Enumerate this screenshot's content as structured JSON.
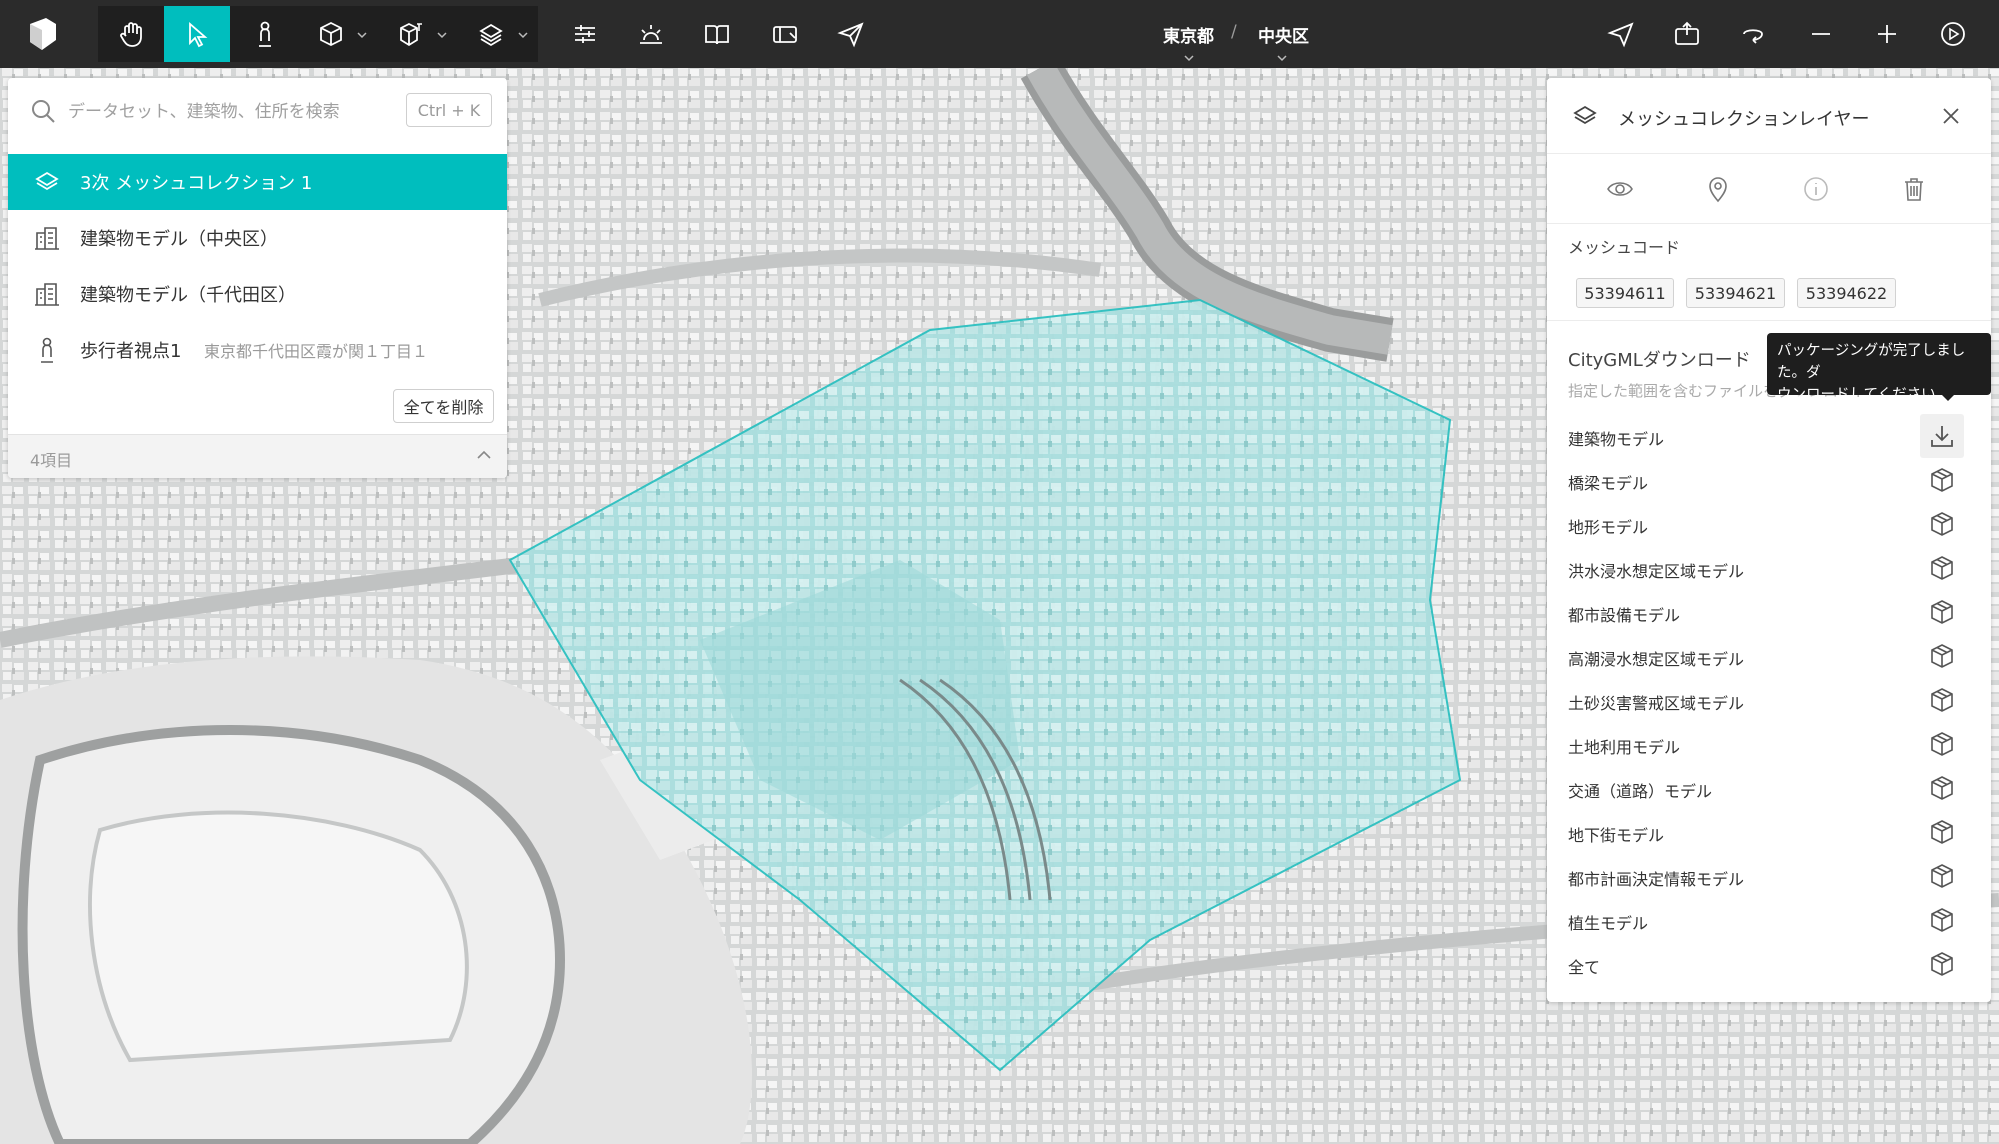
{
  "toolbar": {
    "tools": [
      {
        "name": "hand-tool",
        "icon": "hand-icon"
      },
      {
        "name": "select-tool",
        "icon": "cursor-icon",
        "active": true
      },
      {
        "name": "pedestrian-tool",
        "icon": "pedestrian-icon"
      },
      {
        "name": "box-tool",
        "icon": "cube-icon"
      },
      {
        "name": "3d-tool",
        "icon": "3d-box-icon"
      },
      {
        "name": "layer-tool",
        "icon": "layers-icon"
      }
    ],
    "right_tools": [
      "settings-icon",
      "sun-icon",
      "book-icon",
      "storage-icon",
      "send-icon"
    ],
    "breadcrumb": {
      "prefecture": "東京都",
      "separator": "/",
      "ward": "中央区"
    },
    "far_right_tools": [
      "location-icon",
      "export-icon",
      "rotate-icon",
      "zoom-out-icon",
      "zoom-in-icon",
      "play-icon"
    ]
  },
  "search": {
    "placeholder": "データセット、建築物、住所を検索",
    "shortcut": "Ctrl + K",
    "items": [
      {
        "label": "3次 メッシュコレクション 1",
        "icon": "layers-icon",
        "selected": true
      },
      {
        "label": "建築物モデル（中央区）",
        "icon": "building-icon"
      },
      {
        "label": "建築物モデル（千代田区）",
        "icon": "building-icon"
      },
      {
        "label": "歩行者視点1",
        "sub": "東京都千代田区霞が関１丁目１",
        "icon": "pedestrian-icon"
      }
    ],
    "clear_label": "全てを削除",
    "count": "4項目"
  },
  "layer_panel": {
    "title": "メッシュコレクションレイヤー",
    "mesh_code_title": "メッシュコード",
    "mesh_codes": [
      "53394611",
      "53394621",
      "53394622"
    ],
    "gml_title": "CityGMLダウンロード",
    "gml_desc": "指定した範囲を含むファイルをダウンロード",
    "models": [
      {
        "label": "建築物モデル",
        "state": "download"
      },
      {
        "label": "橋梁モデル",
        "state": "package"
      },
      {
        "label": "地形モデル",
        "state": "package"
      },
      {
        "label": "洪水浸水想定区域モデル",
        "state": "package"
      },
      {
        "label": "都市設備モデル",
        "state": "package"
      },
      {
        "label": "高潮浸水想定区域モデル",
        "state": "package"
      },
      {
        "label": "土砂災害警戒区域モデル",
        "state": "package"
      },
      {
        "label": "土地利用モデル",
        "state": "package"
      },
      {
        "label": "交通（道路）モデル",
        "state": "package"
      },
      {
        "label": "地下街モデル",
        "state": "package"
      },
      {
        "label": "都市計画決定情報モデル",
        "state": "package"
      },
      {
        "label": "植生モデル",
        "state": "package"
      },
      {
        "label": "全て",
        "state": "package"
      }
    ]
  },
  "tooltip": {
    "line1": "パッケージングが完了しました。ダ",
    "line2": "ウンロードしてください。"
  },
  "colors": {
    "accent": "#00bebe",
    "toolbar_bg": "#2b2b2b",
    "mesh_overlay": "#8fd6d6"
  }
}
